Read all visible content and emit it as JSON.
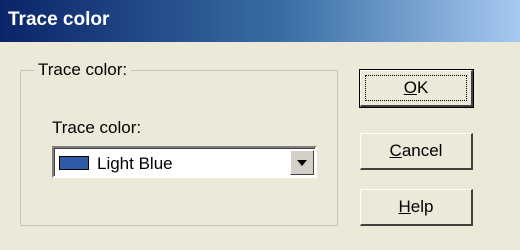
{
  "window": {
    "title": "Trace color"
  },
  "group": {
    "legend": "Trace color:"
  },
  "field": {
    "label": "Trace color:",
    "selected_value": "Light Blue",
    "swatch_color": "#2f5aa8"
  },
  "buttons": {
    "ok": {
      "mnemonic": "O",
      "rest": "K"
    },
    "cancel": {
      "mnemonic": "C",
      "rest": "ancel"
    },
    "help": {
      "mnemonic": "H",
      "rest": "elp"
    }
  },
  "colors": {
    "dialog_background": "#ece9d8",
    "titlebar_start": "#0a246a",
    "titlebar_end": "#a6caf0"
  }
}
